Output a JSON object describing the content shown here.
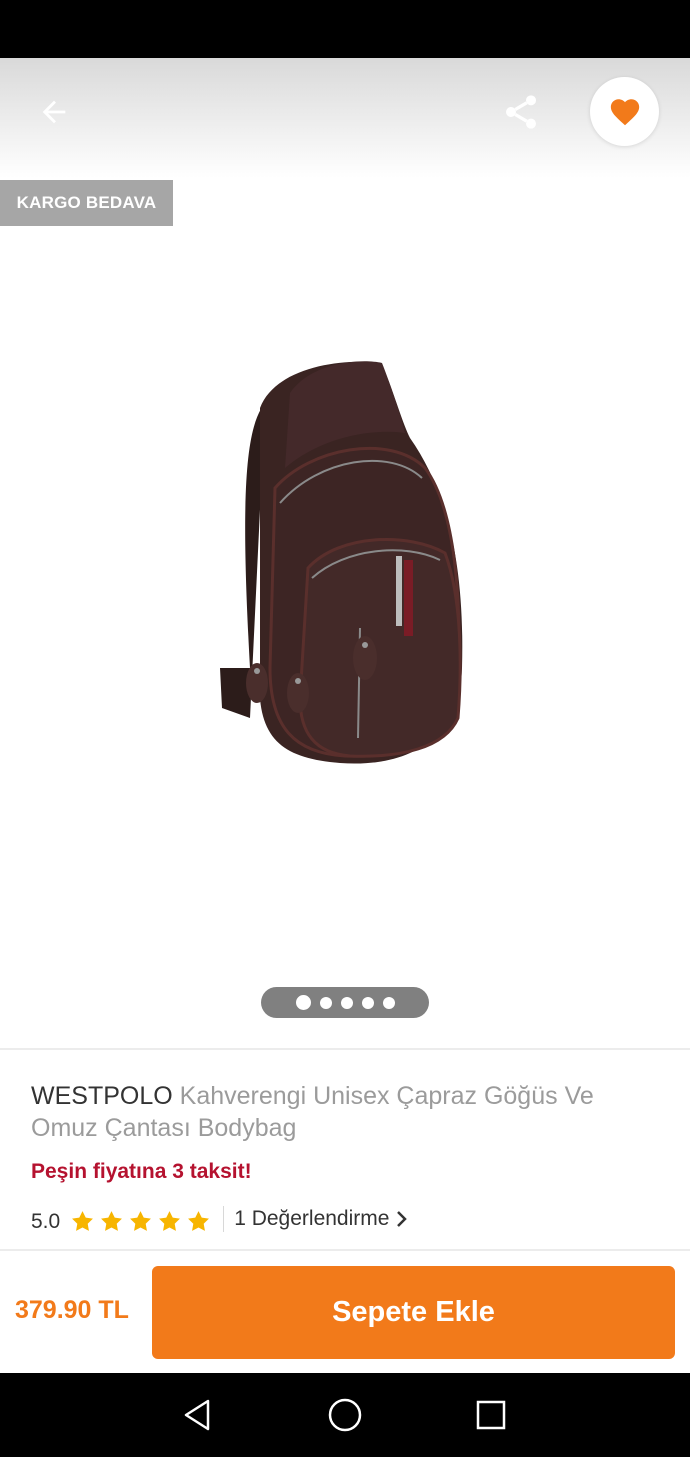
{
  "product": {
    "badge": "KARGO BEDAVA",
    "brand": "WESTPOLO",
    "name": "Kahverengi Unisex Çapraz Göğüs Ve Omuz Çantası Bodybag",
    "installment": "Peşin fiyatına 3 taksit!",
    "rating": "5.0",
    "star_count": 5,
    "reviews_label": "1 Değerlendirme",
    "price": "379.90 TL",
    "images_total": 5,
    "image_active": 1
  },
  "actions": {
    "add_to_cart": "Sepete Ekle"
  },
  "icons": {
    "back": "arrow-left-icon",
    "share": "share-icon",
    "favorite": "heart-icon",
    "review_chevron": "chevron-right-icon"
  },
  "colors": {
    "accent": "#f27a1a",
    "installment": "#b5122f",
    "star": "#f7b500",
    "badge": "#a6a6a6"
  }
}
